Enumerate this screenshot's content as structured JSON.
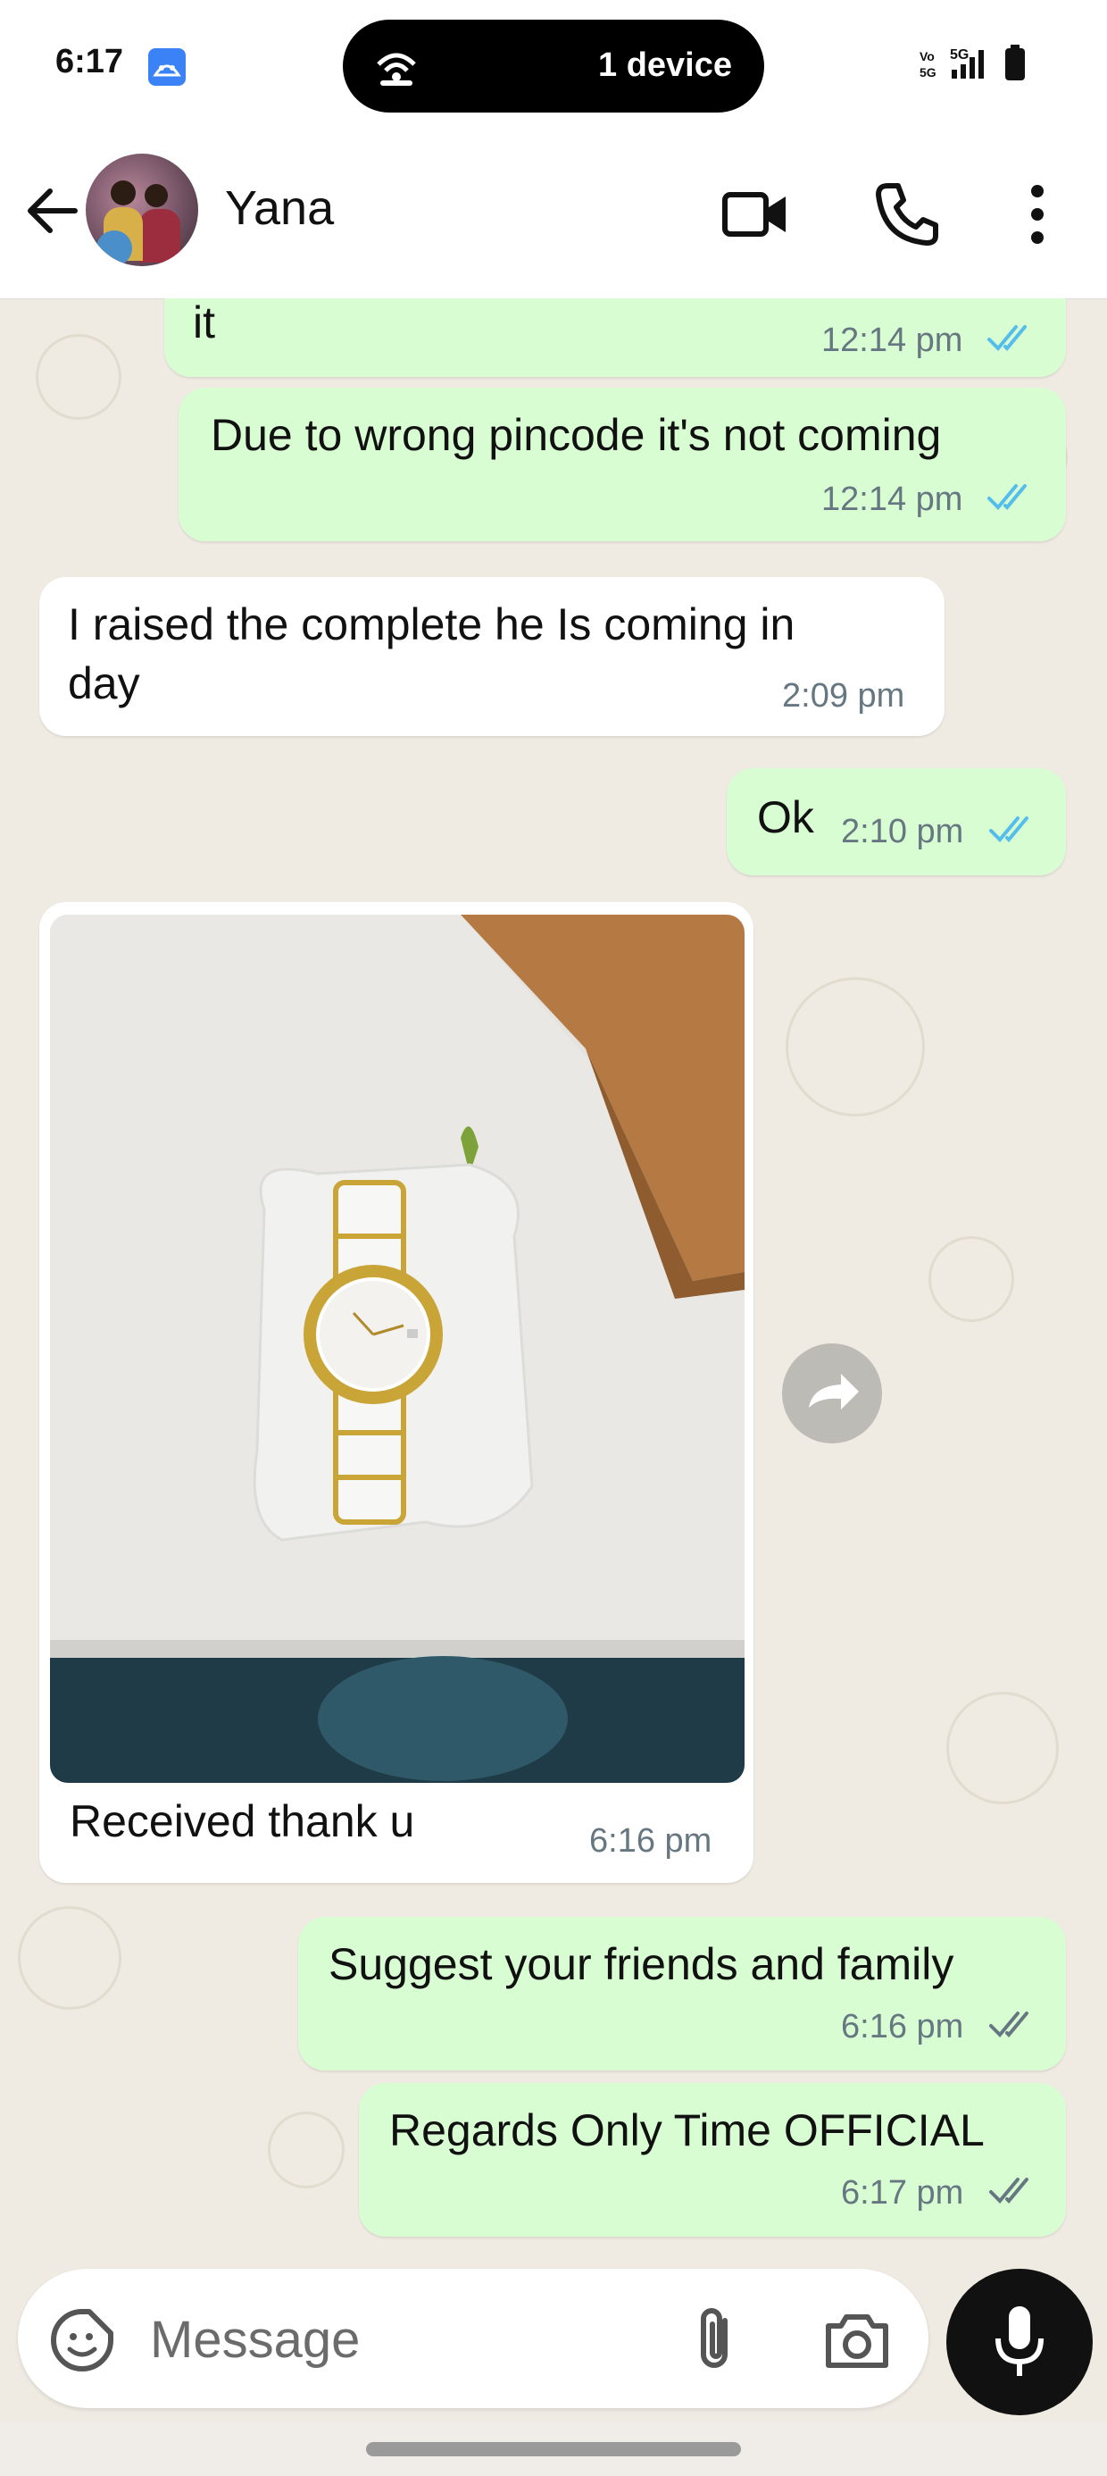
{
  "status_bar": {
    "time": "6:17",
    "pill_label": "1 device"
  },
  "header": {
    "contact_name": "Yana"
  },
  "messages": [
    {
      "direction": "out",
      "text": "it",
      "time": "12:14 pm",
      "read": "read-blue"
    },
    {
      "direction": "out",
      "text": "Due to wrong pincode it's not coming",
      "time": "12:14 pm",
      "read": "read-blue"
    },
    {
      "direction": "in",
      "text_line1": "I raised the complete he Is coming in",
      "text_line2": "day",
      "time": "2:09 pm"
    },
    {
      "direction": "out",
      "text": "Ok",
      "time": "2:10 pm",
      "read": "read-blue"
    },
    {
      "direction": "in",
      "caption": "Received thank u",
      "time": "6:16 pm",
      "image": "watch-photo"
    },
    {
      "direction": "out",
      "text": "Suggest your friends and family",
      "time": "6:16 pm",
      "read": "delivered-grey"
    },
    {
      "direction": "out",
      "text": "Regards Only Time OFFICIAL",
      "time": "6:17 pm",
      "read": "delivered-grey"
    }
  ],
  "composer": {
    "placeholder": "Message"
  },
  "colors": {
    "outgoing_bubble": "#d9fdd3",
    "incoming_bubble": "#ffffff",
    "chat_background": "#efeae2",
    "read_tick": "#53bdeb",
    "meta_text": "#667781"
  }
}
